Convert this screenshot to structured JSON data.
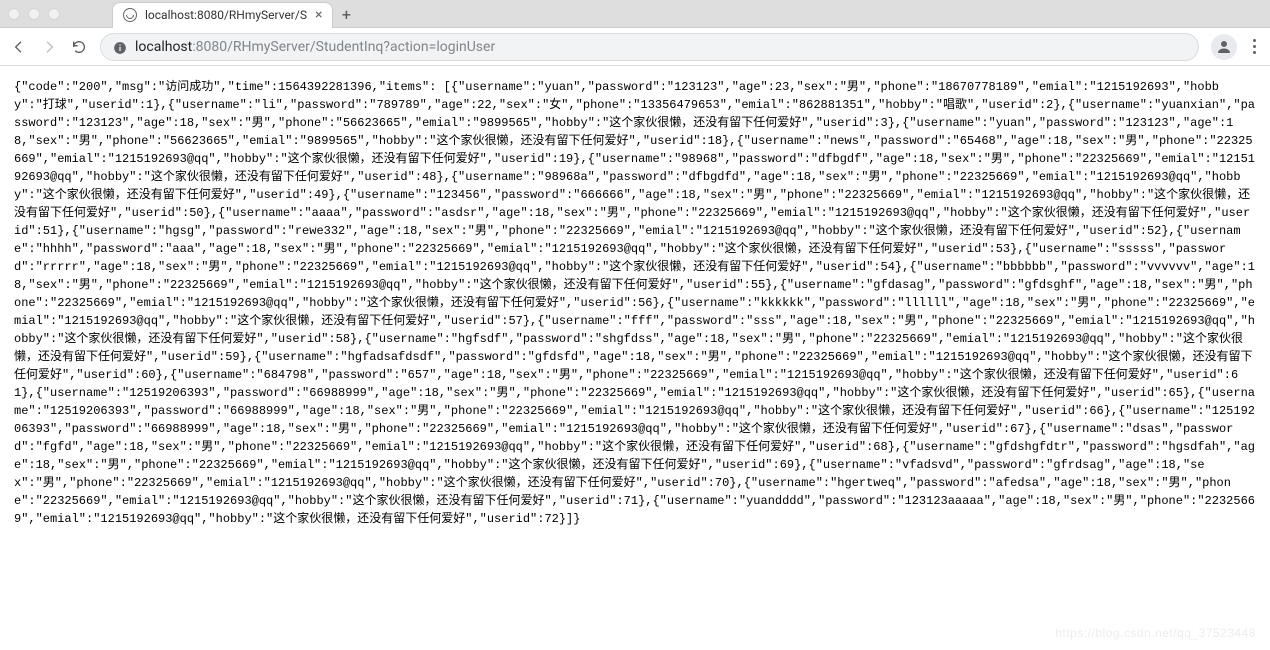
{
  "window": {
    "tab_title": "localhost:8080/RHmyServer/S",
    "new_tab_label": "+"
  },
  "addressbar": {
    "protocol_host": "localhost",
    "port_path": ":8080/RHmyServer/StudentInq?action=loginUser"
  },
  "response": {
    "code": "200",
    "msg": "访问成功",
    "time": 1564392281396,
    "items": [
      {
        "username": "yuan",
        "password": "123123",
        "age": 23,
        "sex": "男",
        "phone": "18670778189",
        "emial": "1215192693",
        "hobby": "打球",
        "userid": 1
      },
      {
        "username": "li",
        "password": "789789",
        "age": 22,
        "sex": "女",
        "phone": "13356479653",
        "emial": "862881351",
        "hobby": "唱歌",
        "userid": 2
      },
      {
        "username": "yuanxian",
        "password": "123123",
        "age": 18,
        "sex": "男",
        "phone": "56623665",
        "emial": "9899565",
        "hobby": "这个家伙很懒，还没有留下任何爱好",
        "userid": 3
      },
      {
        "username": "yuan",
        "password": "123123",
        "age": 18,
        "sex": "男",
        "phone": "56623665",
        "emial": "9899565",
        "hobby": "这个家伙很懒，还没有留下任何爱好",
        "userid": 18
      },
      {
        "username": "news",
        "password": "65468",
        "age": 18,
        "sex": "男",
        "phone": "22325669",
        "emial": "1215192693@qq",
        "hobby": "这个家伙很懒，还没有留下任何爱好",
        "userid": 19
      },
      {
        "username": "98968",
        "password": "dfbgdf",
        "age": 18,
        "sex": "男",
        "phone": "22325669",
        "emial": "1215192693@qq",
        "hobby": "这个家伙很懒，还没有留下任何爱好",
        "userid": 48
      },
      {
        "username": "98968a",
        "password": "dfbgdfd",
        "age": 18,
        "sex": "男",
        "phone": "22325669",
        "emial": "1215192693@qq",
        "hobby": "这个家伙很懒，还没有留下任何爱好",
        "userid": 49
      },
      {
        "username": "123456",
        "password": "666666",
        "age": 18,
        "sex": "男",
        "phone": "22325669",
        "emial": "1215192693@qq",
        "hobby": "这个家伙很懒，还没有留下任何爱好",
        "userid": 50
      },
      {
        "username": "aaaa",
        "password": "asdsr",
        "age": 18,
        "sex": "男",
        "phone": "22325669",
        "emial": "1215192693@qq",
        "hobby": "这个家伙很懒，还没有留下任何爱好",
        "userid": 51
      },
      {
        "username": "hgsg",
        "password": "rewe332",
        "age": 18,
        "sex": "男",
        "phone": "22325669",
        "emial": "1215192693@qq",
        "hobby": "这个家伙很懒，还没有留下任何爱好",
        "userid": 52
      },
      {
        "username": "hhhh",
        "password": "aaa",
        "age": 18,
        "sex": "男",
        "phone": "22325669",
        "emial": "1215192693@qq",
        "hobby": "这个家伙很懒，还没有留下任何爱好",
        "userid": 53
      },
      {
        "username": "sssss",
        "password": "rrrrr",
        "age": 18,
        "sex": "男",
        "phone": "22325669",
        "emial": "1215192693@qq",
        "hobby": "这个家伙很懒，还没有留下任何爱好",
        "userid": 54
      },
      {
        "username": "bbbbbb",
        "password": "vvvvvv",
        "age": 18,
        "sex": "男",
        "phone": "22325669",
        "emial": "1215192693@qq",
        "hobby": "这个家伙很懒，还没有留下任何爱好",
        "userid": 55
      },
      {
        "username": "gfdasag",
        "password": "gfdsghf",
        "age": 18,
        "sex": "男",
        "phone": "22325669",
        "emial": "1215192693@qq",
        "hobby": "这个家伙很懒，还没有留下任何爱好",
        "userid": 56
      },
      {
        "username": "kkkkkk",
        "password": "llllll",
        "age": 18,
        "sex": "男",
        "phone": "22325669",
        "emial": "1215192693@qq",
        "hobby": "这个家伙很懒，还没有留下任何爱好",
        "userid": 57
      },
      {
        "username": "fff",
        "password": "sss",
        "age": 18,
        "sex": "男",
        "phone": "22325669",
        "emial": "1215192693@qq",
        "hobby": "这个家伙很懒，还没有留下任何爱好",
        "userid": 58
      },
      {
        "username": "hgfsdf",
        "password": "shgfdss",
        "age": 18,
        "sex": "男",
        "phone": "22325669",
        "emial": "1215192693@qq",
        "hobby": "这个家伙很懒，还没有留下任何爱好",
        "userid": 59
      },
      {
        "username": "hgfadsafdsdf",
        "password": "gfdsfd",
        "age": 18,
        "sex": "男",
        "phone": "22325669",
        "emial": "1215192693@qq",
        "hobby": "这个家伙很懒，还没有留下任何爱好",
        "userid": 60
      },
      {
        "username": "684798",
        "password": "657",
        "age": 18,
        "sex": "男",
        "phone": "22325669",
        "emial": "1215192693@qq",
        "hobby": "这个家伙很懒，还没有留下任何爱好",
        "userid": 61
      },
      {
        "username": "12519206393",
        "password": "66988999",
        "age": 18,
        "sex": "男",
        "phone": "22325669",
        "emial": "1215192693@qq",
        "hobby": "这个家伙很懒，还没有留下任何爱好",
        "userid": 65
      },
      {
        "username": "12519206393",
        "password": "66988999",
        "age": 18,
        "sex": "男",
        "phone": "22325669",
        "emial": "1215192693@qq",
        "hobby": "这个家伙很懒，还没有留下任何爱好",
        "userid": 66
      },
      {
        "username": "12519206393",
        "password": "66988999",
        "age": 18,
        "sex": "男",
        "phone": "22325669",
        "emial": "1215192693@qq",
        "hobby": "这个家伙很懒，还没有留下任何爱好",
        "userid": 67
      },
      {
        "username": "dsas",
        "password": "fgfd",
        "age": 18,
        "sex": "男",
        "phone": "22325669",
        "emial": "1215192693@qq",
        "hobby": "这个家伙很懒，还没有留下任何爱好",
        "userid": 68
      },
      {
        "username": "gfdshgfdtr",
        "password": "hgsdfah",
        "age": 18,
        "sex": "男",
        "phone": "22325669",
        "emial": "1215192693@qq",
        "hobby": "这个家伙很懒，还没有留下任何爱好",
        "userid": 69
      },
      {
        "username": "vfadsvd",
        "password": "gfrdsag",
        "age": 18,
        "sex": "男",
        "phone": "22325669",
        "emial": "1215192693@qq",
        "hobby": "这个家伙很懒，还没有留下任何爱好",
        "userid": 70
      },
      {
        "username": "hgertweq",
        "password": "afedsa",
        "age": 18,
        "sex": "男",
        "phone": "22325669",
        "emial": "1215192693@qq",
        "hobby": "这个家伙很懒，还没有留下任何爱好",
        "userid": 71
      },
      {
        "username": "yuandddd",
        "password": "123123aaaaa",
        "age": 18,
        "sex": "男",
        "phone": "22325669",
        "emial": "1215192693@qq",
        "hobby": "这个家伙很懒，还没有留下任何爱好",
        "userid": 72
      }
    ]
  },
  "watermark": "https://blog.csdn.net/qq_37523448"
}
